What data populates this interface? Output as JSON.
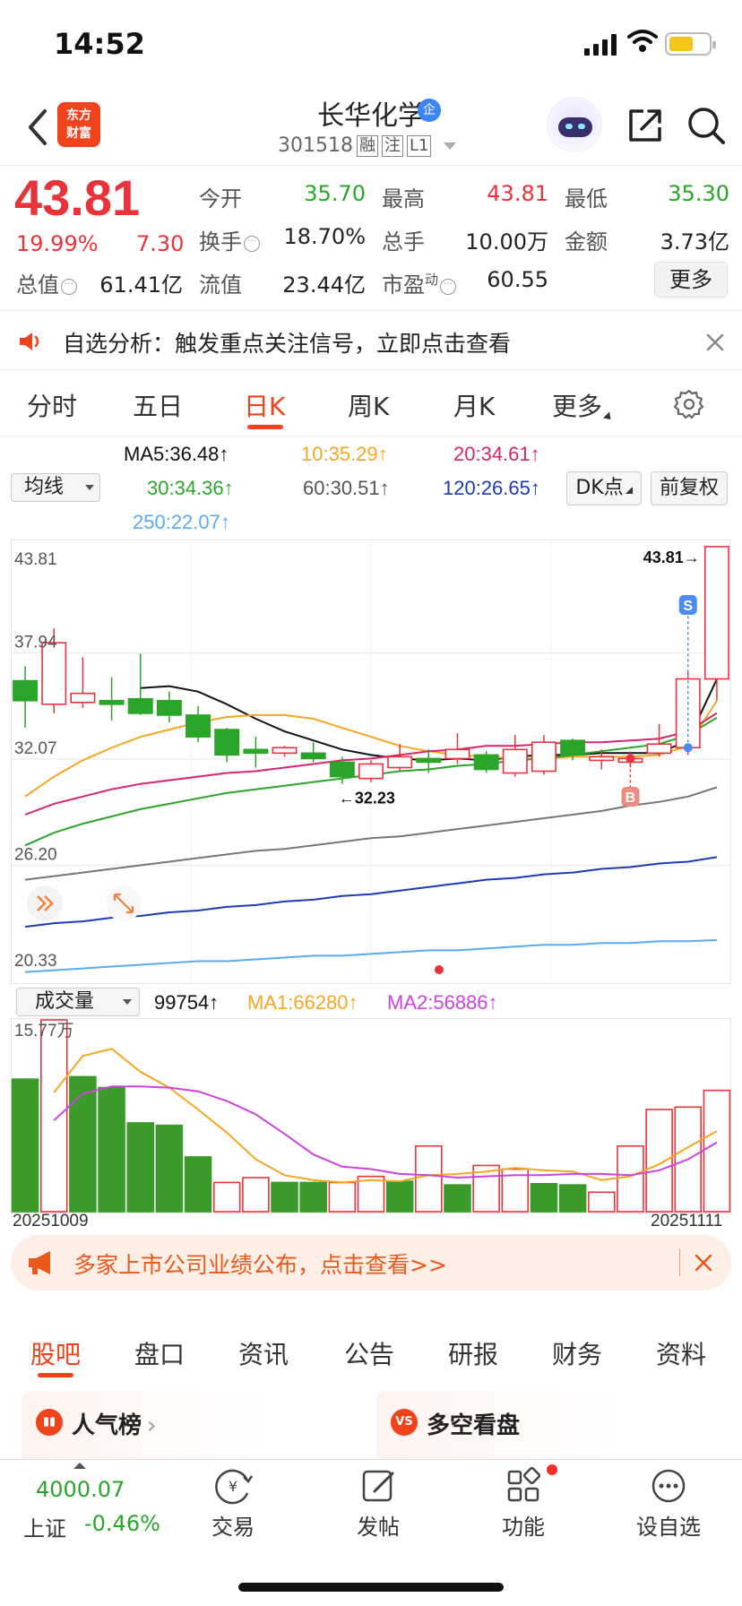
{
  "status_bar": {
    "time": "14:52"
  },
  "header": {
    "logo_line1": "东方",
    "logo_line2": "财富",
    "stock_name": "长华化学",
    "badge": "企",
    "code": "301518",
    "tags": [
      "融",
      "注",
      "L1"
    ]
  },
  "quote": {
    "price": "43.81",
    "change_pct": "19.99%",
    "change_amt": "7.30",
    "fields": [
      {
        "label": "今开",
        "value": "35.70",
        "color": "green"
      },
      {
        "label": "最高",
        "value": "43.81",
        "color": "red"
      },
      {
        "label": "最低",
        "value": "35.30",
        "color": "green"
      },
      {
        "label": "换手",
        "value": "18.70%",
        "color": "normal",
        "info": true
      },
      {
        "label": "总手",
        "value": "10.00万",
        "color": "normal"
      },
      {
        "label": "金额",
        "value": "3.73亿",
        "color": "normal"
      },
      {
        "label": "总值",
        "value": "61.41亿",
        "color": "normal",
        "info": true
      },
      {
        "label": "流值",
        "value": "23.44亿",
        "color": "normal"
      },
      {
        "label": "市盈",
        "sup": "动",
        "value": "60.55",
        "color": "normal",
        "info": true
      }
    ],
    "more_label": "更多"
  },
  "notice": {
    "text": "自选分析：触发重点关注信号，立即点击查看"
  },
  "period_tabs": [
    {
      "label": "分时",
      "active": false
    },
    {
      "label": "五日",
      "active": false
    },
    {
      "label": "日K",
      "active": true
    },
    {
      "label": "周K",
      "active": false
    },
    {
      "label": "月K",
      "active": false
    },
    {
      "label": "更多",
      "active": false
    }
  ],
  "ma_bar": {
    "dropdown": "均线",
    "items": [
      {
        "text": "MA5:36.48↑",
        "color": "#111111"
      },
      {
        "text": "10:35.29↑",
        "color": "#f5a623"
      },
      {
        "text": "20:34.61↑",
        "color": "#d6246e"
      },
      {
        "text": "30:34.36↑",
        "color": "#2aa52a"
      },
      {
        "text": "60:30.51↑",
        "color": "#555555"
      },
      {
        "text": "120:26.65↑",
        "color": "#1f3bb3"
      },
      {
        "text": "250:22.07↑",
        "color": "#5aaaf0"
      }
    ],
    "dk_label": "DK点",
    "adjust_label": "前复权"
  },
  "chart_data": [
    {
      "type": "candlestick",
      "title": "",
      "y_labels": [
        "43.81",
        "37.94",
        "32.07",
        "26.20",
        "20.33"
      ],
      "ylim": [
        20.33,
        43.81
      ],
      "high_marker": "43.81",
      "low_marker": "32.23",
      "sell_marker": "S",
      "buy_marker": "B",
      "up_color": "#e8333b",
      "down_color": "#2aa52a",
      "candles": [
        {
          "o": 36.4,
          "c": 35.3,
          "h": 37.2,
          "l": 33.8
        },
        {
          "o": 35.1,
          "c": 38.5,
          "h": 39.3,
          "l": 34.6
        },
        {
          "o": 35.2,
          "c": 35.7,
          "h": 37.7,
          "l": 34.9
        },
        {
          "o": 35.3,
          "c": 35.1,
          "h": 36.6,
          "l": 34.2
        },
        {
          "o": 35.4,
          "c": 34.6,
          "h": 37.9,
          "l": 34.5
        },
        {
          "o": 35.3,
          "c": 34.5,
          "h": 35.8,
          "l": 34.1
        },
        {
          "o": 34.5,
          "c": 33.3,
          "h": 35.0,
          "l": 33.0
        },
        {
          "o": 33.7,
          "c": 32.3,
          "h": 33.8,
          "l": 31.9
        },
        {
          "o": 32.6,
          "c": 32.4,
          "h": 33.3,
          "l": 31.6
        },
        {
          "o": 32.4,
          "c": 32.7,
          "h": 32.8,
          "l": 32.2
        },
        {
          "o": 32.4,
          "c": 32.1,
          "h": 33.0,
          "l": 31.9
        },
        {
          "o": 31.9,
          "c": 31.1,
          "h": 32.2,
          "l": 30.7
        },
        {
          "o": 31.0,
          "c": 31.8,
          "h": 32.0,
          "l": 30.8
        },
        {
          "o": 31.6,
          "c": 32.2,
          "h": 32.9,
          "l": 31.4
        },
        {
          "o": 32.1,
          "c": 31.9,
          "h": 32.6,
          "l": 31.3
        },
        {
          "o": 32.1,
          "c": 32.6,
          "h": 33.5,
          "l": 31.8
        },
        {
          "o": 32.3,
          "c": 31.5,
          "h": 32.5,
          "l": 31.3
        },
        {
          "o": 31.3,
          "c": 32.6,
          "h": 33.4,
          "l": 31.1
        },
        {
          "o": 31.4,
          "c": 33.0,
          "h": 33.4,
          "l": 31.2
        },
        {
          "o": 33.1,
          "c": 32.3,
          "h": 33.2,
          "l": 32.0
        },
        {
          "o": 32.0,
          "c": 32.2,
          "h": 32.6,
          "l": 31.5
        },
        {
          "o": 31.9,
          "c": 32.1,
          "h": 32.5,
          "l": 31.6
        },
        {
          "o": 32.4,
          "c": 32.9,
          "h": 34.0,
          "l": 32.2
        },
        {
          "o": 32.7,
          "c": 36.5,
          "h": 37.0,
          "l": 32.3
        },
        {
          "o": 36.5,
          "c": 43.81,
          "h": 43.81,
          "l": 35.3
        }
      ],
      "series": [
        {
          "name": "MA5",
          "color": "#111111",
          "values": [
            null,
            null,
            null,
            null,
            36.0,
            36.1,
            35.8,
            35.1,
            34.3,
            33.6,
            33.1,
            32.6,
            32.3,
            32.1,
            32.0,
            32.1,
            32.0,
            32.2,
            32.3,
            32.3,
            32.4,
            32.4,
            32.4,
            33.1,
            36.48
          ]
        },
        {
          "name": "MA10",
          "color": "#f5a623",
          "values": [
            30.0,
            31.1,
            32.0,
            32.7,
            33.3,
            33.7,
            34.1,
            34.4,
            34.5,
            34.5,
            34.3,
            33.8,
            33.3,
            32.8,
            32.5,
            32.3,
            32.2,
            32.1,
            32.1,
            32.2,
            32.2,
            32.2,
            32.3,
            32.8,
            35.29
          ]
        },
        {
          "name": "MA20",
          "color": "#d6246e",
          "values": [
            29.0,
            29.6,
            30.0,
            30.4,
            30.7,
            30.9,
            31.1,
            31.3,
            31.4,
            31.6,
            31.8,
            32.0,
            32.1,
            32.3,
            32.5,
            32.6,
            32.8,
            32.8,
            32.9,
            33.0,
            33.0,
            33.1,
            33.2,
            33.6,
            34.61
          ]
        },
        {
          "name": "MA30",
          "color": "#2aa52a",
          "values": [
            27.3,
            28.0,
            28.5,
            28.9,
            29.3,
            29.6,
            29.9,
            30.2,
            30.4,
            30.6,
            30.8,
            31.0,
            31.2,
            31.4,
            31.5,
            31.7,
            31.8,
            32.0,
            32.1,
            32.3,
            32.5,
            32.7,
            32.9,
            33.4,
            34.36
          ]
        },
        {
          "name": "MA60",
          "color": "#777777",
          "values": [
            25.4,
            25.6,
            25.8,
            26.0,
            26.2,
            26.4,
            26.6,
            26.8,
            27.0,
            27.1,
            27.3,
            27.5,
            27.7,
            27.8,
            28.0,
            28.2,
            28.4,
            28.6,
            28.8,
            29.0,
            29.2,
            29.5,
            29.7,
            30.0,
            30.51
          ]
        },
        {
          "name": "MA120",
          "color": "#1f3bb3",
          "values": [
            22.8,
            23.0,
            23.1,
            23.3,
            23.4,
            23.6,
            23.7,
            23.9,
            24.0,
            24.2,
            24.3,
            24.5,
            24.6,
            24.8,
            25.0,
            25.2,
            25.4,
            25.5,
            25.7,
            25.8,
            26.0,
            26.1,
            26.3,
            26.4,
            26.65
          ]
        },
        {
          "name": "MA250",
          "color": "#5aaaf0",
          "values": [
            20.3,
            20.4,
            20.5,
            20.6,
            20.7,
            20.8,
            20.9,
            20.9,
            21.0,
            21.1,
            21.2,
            21.2,
            21.3,
            21.4,
            21.5,
            21.5,
            21.6,
            21.7,
            21.8,
            21.8,
            21.9,
            21.9,
            22.0,
            22.0,
            22.07
          ]
        }
      ]
    },
    {
      "type": "bar",
      "title": "",
      "y_label": "15.77万",
      "ylim": [
        0,
        157700
      ],
      "x_start": "20251009",
      "x_end": "20251111",
      "values": [
        109000,
        157700,
        111000,
        102000,
        73000,
        71000,
        45000,
        24000,
        28000,
        24000,
        24000,
        24000,
        29000,
        25000,
        54000,
        22000,
        38000,
        35000,
        23000,
        22000,
        16000,
        54000,
        84000,
        86000,
        99754
      ],
      "up": [
        false,
        true,
        false,
        false,
        false,
        false,
        false,
        true,
        true,
        false,
        false,
        true,
        true,
        false,
        true,
        false,
        true,
        true,
        false,
        false,
        true,
        true,
        true,
        true,
        true
      ],
      "series": [
        {
          "name": "MA1",
          "color": "#f5a623",
          "values": [
            null,
            98000,
            128000,
            134000,
            115000,
            102000,
            84000,
            65000,
            43000,
            30000,
            26000,
            24000,
            26000,
            25000,
            30000,
            31000,
            33000,
            36000,
            34000,
            33000,
            26000,
            29000,
            39000,
            53000,
            66280
          ]
        },
        {
          "name": "MA2",
          "color": "#cc44dd",
          "values": [
            null,
            75000,
            97000,
            103000,
            103000,
            102000,
            99000,
            91000,
            80000,
            64000,
            47000,
            37000,
            35000,
            31000,
            30000,
            28000,
            29000,
            30000,
            30000,
            31000,
            31000,
            30000,
            34000,
            43000,
            56886
          ]
        }
      ]
    }
  ],
  "volume_bar": {
    "dropdown": "成交量",
    "current": "99754↑",
    "ma1": "MA1:66280↑",
    "ma2": "MA2:56886↑"
  },
  "banner": {
    "text": "多家上市公司业绩公布，点击查看>>"
  },
  "info_tabs": [
    {
      "label": "股吧",
      "active": true
    },
    {
      "label": "盘口",
      "active": false
    },
    {
      "label": "资讯",
      "active": false
    },
    {
      "label": "公告",
      "active": false
    },
    {
      "label": "研报",
      "active": false
    },
    {
      "label": "财务",
      "active": false
    },
    {
      "label": "资料",
      "active": false
    }
  ],
  "cards": [
    {
      "title": "人气榜"
    },
    {
      "title": "多空看盘"
    }
  ],
  "footer": {
    "index_value": "4000.07",
    "index_name": "上证",
    "index_change": "-0.46%",
    "buttons": [
      {
        "label": "交易",
        "icon": "trade-icon"
      },
      {
        "label": "发帖",
        "icon": "post-icon"
      },
      {
        "label": "功能",
        "icon": "apps-icon"
      },
      {
        "label": "设自选",
        "icon": "more-circle-icon"
      }
    ]
  }
}
